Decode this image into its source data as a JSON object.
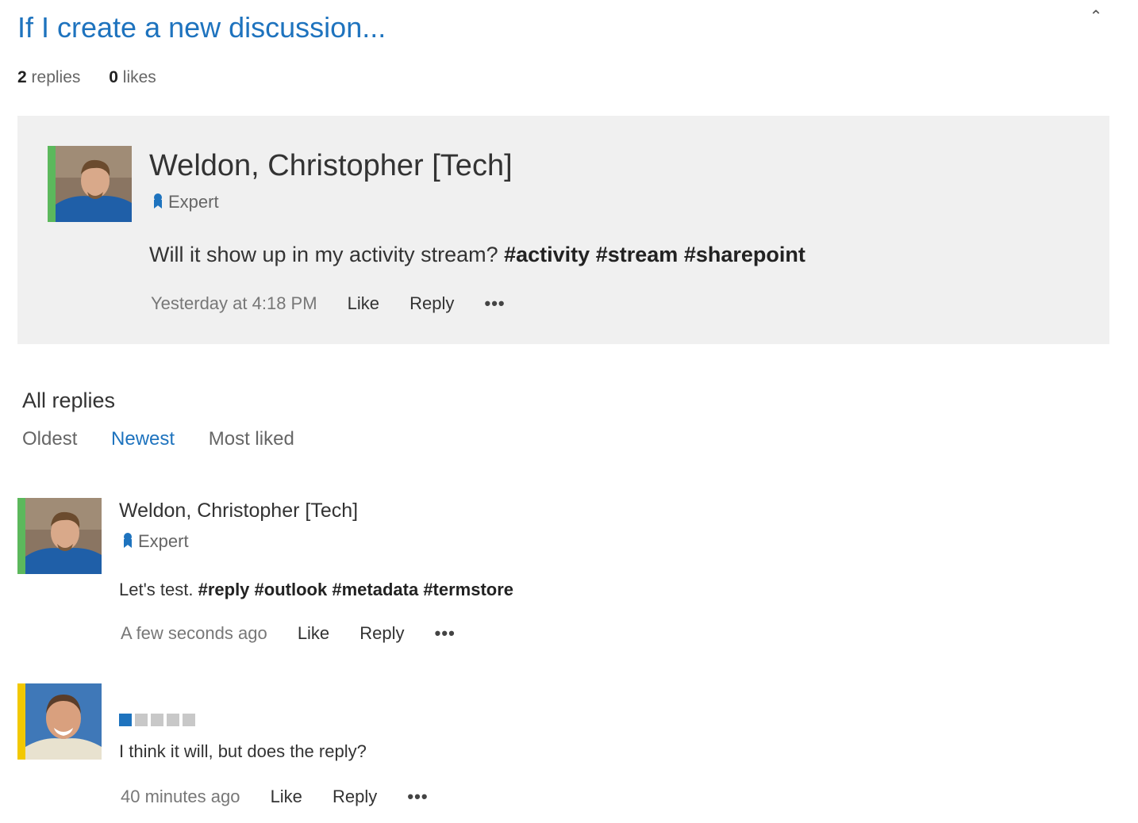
{
  "discussion": {
    "title": "If I create a new discussion...",
    "collapse_icon": "chevron-up-icon",
    "replies_count": "2",
    "replies_label": "replies",
    "likes_count": "0",
    "likes_label": "likes"
  },
  "original_post": {
    "author": "Weldon, Christopher [Tech]",
    "badge": "Expert",
    "presence_color": "#5cb85c",
    "text": "Will it show up in my activity stream?",
    "hashtags": [
      "#activity",
      "#stream",
      "#sharepoint"
    ],
    "time": "Yesterday at 4:18 PM",
    "like_label": "Like",
    "reply_label": "Reply",
    "more_label": "•••"
  },
  "replies_section": {
    "heading": "All replies",
    "sort_options": [
      "Oldest",
      "Newest",
      "Most liked"
    ],
    "active_sort": "Newest",
    "accent_color": "#1e73be"
  },
  "replies": [
    {
      "author": "Weldon, Christopher [Tech]",
      "badge": "Expert",
      "presence_color": "#5cb85c",
      "text": "Let's test.",
      "hashtags": [
        "#reply",
        "#outlook",
        "#metadata",
        "#termstore"
      ],
      "time": "A few seconds ago",
      "like_label": "Like",
      "reply_label": "Reply",
      "more_label": "•••"
    },
    {
      "author": "",
      "reputation_level": 1,
      "reputation_max": 5,
      "presence_color": "#f2c800",
      "text": "I think it will, but does the reply?",
      "time": "40 minutes ago",
      "like_label": "Like",
      "reply_label": "Reply",
      "more_label": "•••"
    }
  ]
}
